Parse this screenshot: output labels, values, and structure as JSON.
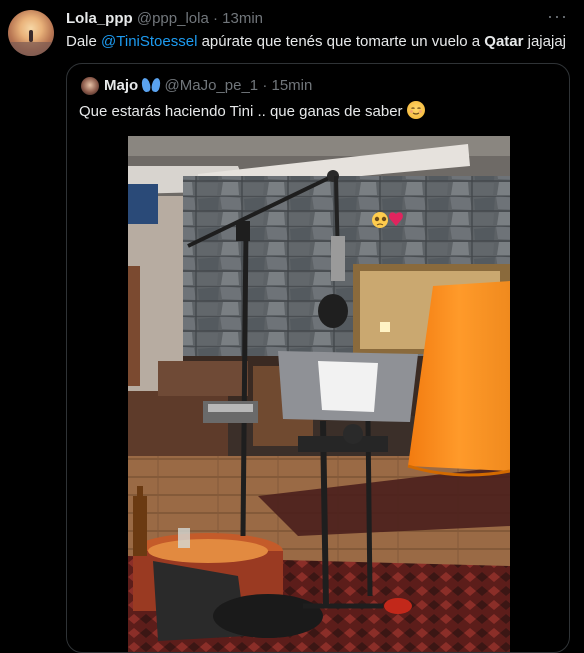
{
  "tweet": {
    "author_name": "Lola_ppp",
    "handle": "@ppp_lola",
    "separator": "·",
    "time": "13min",
    "more": "···",
    "text_parts": {
      "p1": "Dale ",
      "mention": "@TiniStoessel",
      "p2": " apúrate que tenés que tomarte un vuelo a ",
      "bold": "Qatar",
      "p3": " jajajaj"
    }
  },
  "quote": {
    "author_name": "Majo",
    "handle": "@MaJo_pe_1",
    "separator": "·",
    "time": "15min",
    "text": "Que estarás haciendo Tini .. que ganas de saber"
  },
  "icons": {
    "author_badge": "butterfly-emoji",
    "text_emoji": "relieved-face-emoji",
    "photo_emoji_1": "pleading-face-emoji",
    "photo_emoji_2": "red-heart-emoji"
  }
}
